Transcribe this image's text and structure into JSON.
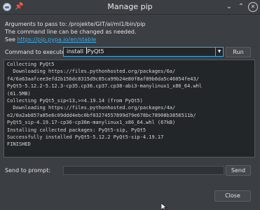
{
  "window": {
    "title": "Manage pip",
    "app_icon": "app-icon",
    "pin_icon": "pin-icon",
    "minimize_glyph": "⌄",
    "maximize_glyph": "⌃",
    "close_glyph": "✕"
  },
  "info": {
    "line1": "Arguments to pass to: /projekte/GIT/ai/ml1/bin/pip",
    "line2": "The command line can be changed as needed.",
    "see_label": "See",
    "link": "https://pip.pypa.io/en/stable"
  },
  "command": {
    "label": "Command to execute:",
    "value_before_caret": "install ",
    "value_after_caret": "PyQt5",
    "dropdown_icon": "chevron-down-icon",
    "dropdown_glyph": "▼",
    "run_label": "Run"
  },
  "output": {
    "lines": [
      "Collecting PyQt5",
      "  Downloading https://files.pythonhosted.org/packages/6a/",
      "f4/6a63aafcee3efd2b156dc8315d9c85ca99b24e80f8af89b6da5c46054fe43/",
      "PyQt5-5.12.2-5.12.3-cp35.cp36.cp37.cp38-abi3-manylinux1_x86_64.whl",
      "(61.5MB)",
      "Collecting PyQt5_sip<13,>=4.19.14 (from PyQt5)",
      "  Downloading https://files.pythonhosted.org/packages/4a/",
      "e2/0a2ab857a85e6c09ddd4ebc0bf03274557899d79e678bc78908b3856511b/",
      "PyQt5_sip-4.19.17-cp36-cp36m-manylinux1_x86_64.whl (67kB)",
      "Installing collected packages: PyQt5-sip, PyQt5",
      "Successfully installed PyQt5-5.12.2 PyQt5-sip-4.19.17",
      "FINISHED"
    ]
  },
  "prompt": {
    "label": "Send to prompt:",
    "value": "",
    "send_label": "Send"
  },
  "footer": {
    "close_label": "Close"
  },
  "colors": {
    "window_bg": "#3b3e43",
    "field_bg": "#232629",
    "accent": "#3daee9"
  }
}
